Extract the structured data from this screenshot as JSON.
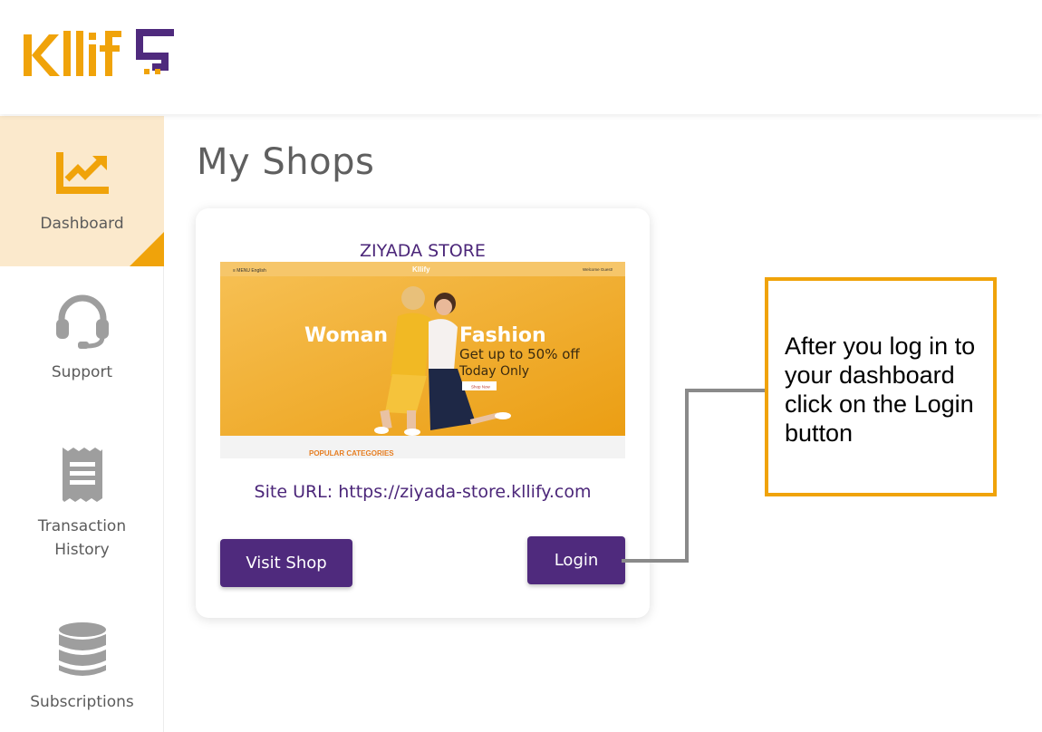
{
  "brand": {
    "name": "Kllify",
    "primary_color": "#f0a30a",
    "accent_color": "#4f2a7d"
  },
  "sidebar": {
    "items": [
      {
        "label": "Dashboard",
        "icon": "chart-trend-icon",
        "active": true
      },
      {
        "label": "Support",
        "icon": "headset-icon",
        "active": false
      },
      {
        "label": "Transaction History",
        "icon": "receipt-icon",
        "active": false
      },
      {
        "label": "Subscriptions",
        "icon": "database-icon",
        "active": false
      }
    ]
  },
  "main": {
    "title": "My Shops",
    "shop": {
      "name": "ZIYADA STORE",
      "preview": {
        "nav_left": "≡ MENU  English",
        "brand": "Kllify",
        "nav_right": "Welcome Guest!",
        "headline_left": "Woman",
        "headline_right": "Fashion",
        "subline1": "Get up to 50% off",
        "subline2": "Today Only",
        "cta": "Shop Now",
        "section": "POPULAR CATEGORIES"
      },
      "site_url": "Site URL: https://ziyada-store.kllify.com",
      "visit_label": "Visit Shop",
      "login_label": "Login"
    }
  },
  "callout": {
    "text": "After you log in to your dashboard click on the Login button"
  }
}
